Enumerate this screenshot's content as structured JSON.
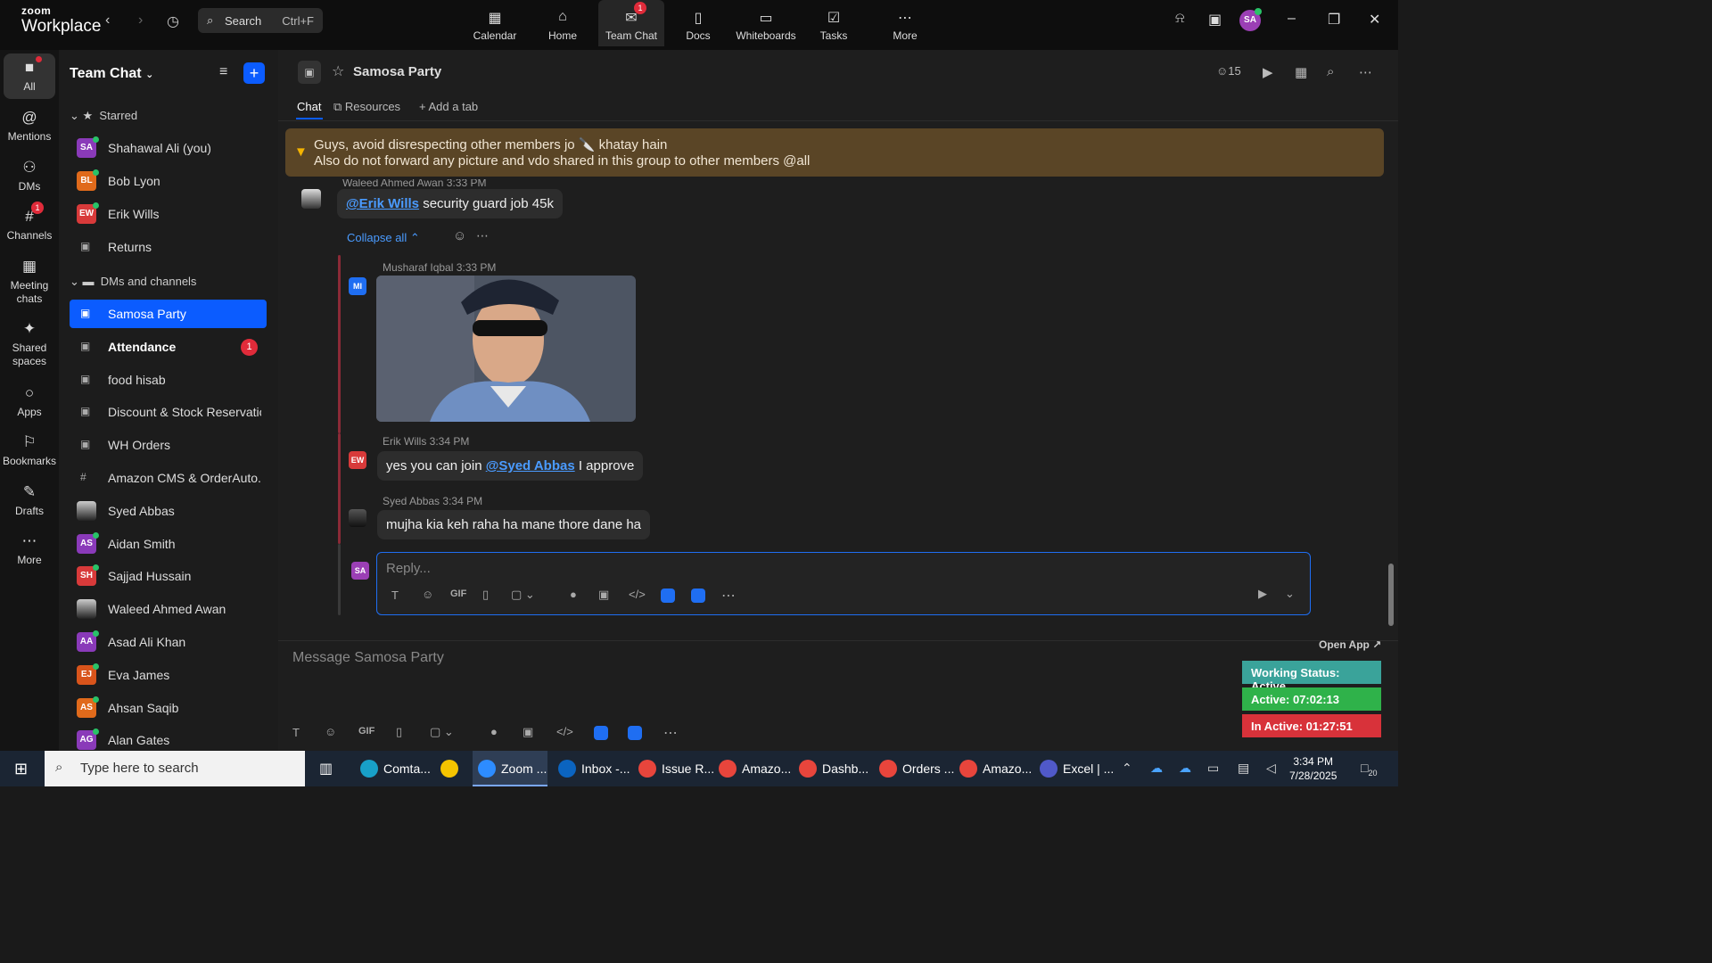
{
  "app": {
    "brand_top": "zoom",
    "brand_bottom": "Workplace"
  },
  "search": {
    "label": "Search",
    "shortcut": "Ctrl+F"
  },
  "top_tabs": [
    {
      "label": "Calendar",
      "icon": "calendar-icon"
    },
    {
      "label": "Home",
      "icon": "home-icon"
    },
    {
      "label": "Team Chat",
      "icon": "chat-icon",
      "badge": "1"
    },
    {
      "label": "Docs",
      "icon": "docs-icon"
    },
    {
      "label": "Whiteboards",
      "icon": "whiteboard-icon"
    },
    {
      "label": "Tasks",
      "icon": "tasks-icon"
    },
    {
      "label": "More",
      "icon": "more-icon"
    }
  ],
  "user": {
    "initials": "SA"
  },
  "rail": [
    {
      "label": "All",
      "icon": "chat-bubble-icon"
    },
    {
      "label": "Mentions",
      "icon": "at-icon"
    },
    {
      "label": "DMs",
      "icon": "people-icon"
    },
    {
      "label": "Channels",
      "icon": "hash-icon",
      "badge": "1"
    },
    {
      "label": "Meeting chats",
      "icon": "calendar-icon"
    },
    {
      "label": "Shared spaces",
      "icon": "shared-icon"
    },
    {
      "label": "Apps",
      "icon": "apps-icon"
    },
    {
      "label": "Bookmarks",
      "icon": "bookmark-icon"
    },
    {
      "label": "Drafts",
      "icon": "drafts-icon"
    },
    {
      "label": "More",
      "icon": "more-icon"
    }
  ],
  "sidebar": {
    "title": "Team Chat",
    "starred_label": "Starred",
    "starred": [
      {
        "name": "Shahawal Ali (you)",
        "initials": "SA",
        "color": "#8a3ab9"
      },
      {
        "name": "Bob Lyon",
        "initials": "BL",
        "color": "#e06a1b"
      },
      {
        "name": "Erik Wills",
        "initials": "EW",
        "color": "#d83a3a"
      },
      {
        "name": "Returns",
        "type": "locked"
      }
    ],
    "dms_label": "DMs and channels",
    "dms": [
      {
        "name": "Samosa Party",
        "type": "locked",
        "selected": true
      },
      {
        "name": "Attendance",
        "type": "locked",
        "bold": true,
        "badge": "1"
      },
      {
        "name": "food hisab",
        "type": "locked"
      },
      {
        "name": "Discount & Stock Reservatio...",
        "type": "locked"
      },
      {
        "name": "WH Orders",
        "type": "locked"
      },
      {
        "name": "Amazon CMS & OrderAuto...",
        "type": "hash"
      },
      {
        "name": "Syed Abbas",
        "type": "photo"
      },
      {
        "name": "Aidan Smith",
        "initials": "AS",
        "color": "#8a3ab9"
      },
      {
        "name": "Sajjad Hussain",
        "initials": "SH",
        "color": "#d83a3a"
      },
      {
        "name": "Waleed Ahmed Awan",
        "type": "photo"
      },
      {
        "name": "Asad Ali Khan",
        "initials": "AA",
        "color": "#8a3ab9"
      },
      {
        "name": "Eva James",
        "initials": "EJ",
        "color": "#d8541b"
      },
      {
        "name": "Ahsan Saqib",
        "initials": "AS",
        "color": "#e06a1b"
      },
      {
        "name": "Alan Gates",
        "initials": "AG",
        "color": "#8a3ab9"
      }
    ]
  },
  "channel": {
    "title": "Samosa Party",
    "member_count": "15",
    "tabs": {
      "chat": "Chat",
      "resources": "Resources",
      "add": "Add a tab"
    }
  },
  "pinned": {
    "line1": "Guys, avoid disrespecting other members jo 🔪 khatay hain",
    "line2": "Also do not forward any picture and vdo shared in this group to other members @all"
  },
  "messages": {
    "m1": {
      "sender": "Waleed Ahmed Awan",
      "time": "3:33 PM",
      "mention": "@Erik Wills",
      "text": " security guard job 45k"
    },
    "collapse": "Collapse all",
    "m2": {
      "sender": "Musharaf Iqbal",
      "time": "3:33 PM",
      "initials": "MI"
    },
    "m3": {
      "sender": "Erik Wills",
      "time": "3:34 PM",
      "initials": "EW",
      "pre": "yes you can join ",
      "mention": "@Syed Abbas",
      "post": " I approve"
    },
    "m4": {
      "sender": "Syed Abbas",
      "time": "3:34 PM",
      "text": "mujha kia keh raha ha mane thore dane ha"
    }
  },
  "reply": {
    "placeholder": "Reply...",
    "avatar": "SA",
    "gif": "GIF"
  },
  "composer": {
    "placeholder": "Message Samosa Party",
    "gif": "GIF"
  },
  "widget": {
    "open_app": "Open App ↗",
    "working": "Working Status: Active",
    "active": "Active: 07:02:13",
    "inactive": "In Active: 01:27:51",
    "colors": {
      "working": "#3aa39a",
      "active": "#2fb24a",
      "inactive": "#d8323a"
    }
  },
  "taskbar": {
    "search_placeholder": "Type here to search",
    "apps": [
      {
        "label": "Comta...",
        "color": "#18a0c8"
      },
      {
        "label": "",
        "color": "#f5c400"
      },
      {
        "label": "Zoom ...",
        "color": "#2d8cff"
      },
      {
        "label": "Inbox -...",
        "color": "#0b64c0"
      },
      {
        "label": "Issue R...",
        "color": "#e8453c"
      },
      {
        "label": "Amazo...",
        "color": "#e8453c"
      },
      {
        "label": "Dashb...",
        "color": "#e8453c"
      },
      {
        "label": "Orders ...",
        "color": "#e8453c"
      },
      {
        "label": "Amazo...",
        "color": "#e8453c"
      },
      {
        "label": "Excel | ...",
        "color": "#5059c9"
      }
    ],
    "time": "3:34 PM",
    "date": "7/28/2025",
    "notif": "20"
  }
}
